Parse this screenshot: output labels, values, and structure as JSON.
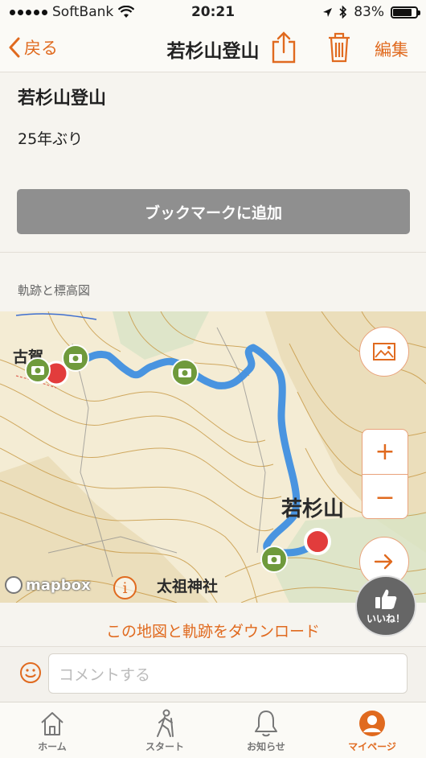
{
  "status_bar": {
    "carrier": "SoftBank",
    "time": "20:21",
    "battery": "83%",
    "battery_level": 0.83
  },
  "nav": {
    "back_label": "戻る",
    "title": "若杉山登山",
    "edit_label": "編集"
  },
  "post": {
    "title": "若杉山登山",
    "body": "25年ぶり",
    "bookmark_label": "ブックマークに追加"
  },
  "map_section": {
    "label": "軌跡と標高図",
    "place_labels": [
      "古賀",
      "若杉山",
      "太祖神社"
    ],
    "attribution": "mapbox",
    "info_label": "i",
    "zoom_in": "+",
    "zoom_out": "−"
  },
  "like": {
    "label": "いいね！"
  },
  "download_label": "この地図と軌跡をダウンロード",
  "comment": {
    "placeholder": "コメントする"
  },
  "tabs": [
    {
      "label": "ホーム",
      "icon": "home-icon"
    },
    {
      "label": "スタート",
      "icon": "walker-icon"
    },
    {
      "label": "お知らせ",
      "icon": "bell-icon"
    },
    {
      "label": "マイページ",
      "icon": "user-icon",
      "active": true
    }
  ],
  "colors": {
    "accent": "#e06a1f",
    "track": "#3f8fe0",
    "photo_marker": "#6f9a3c",
    "map_bg": "#f4ecd4"
  }
}
